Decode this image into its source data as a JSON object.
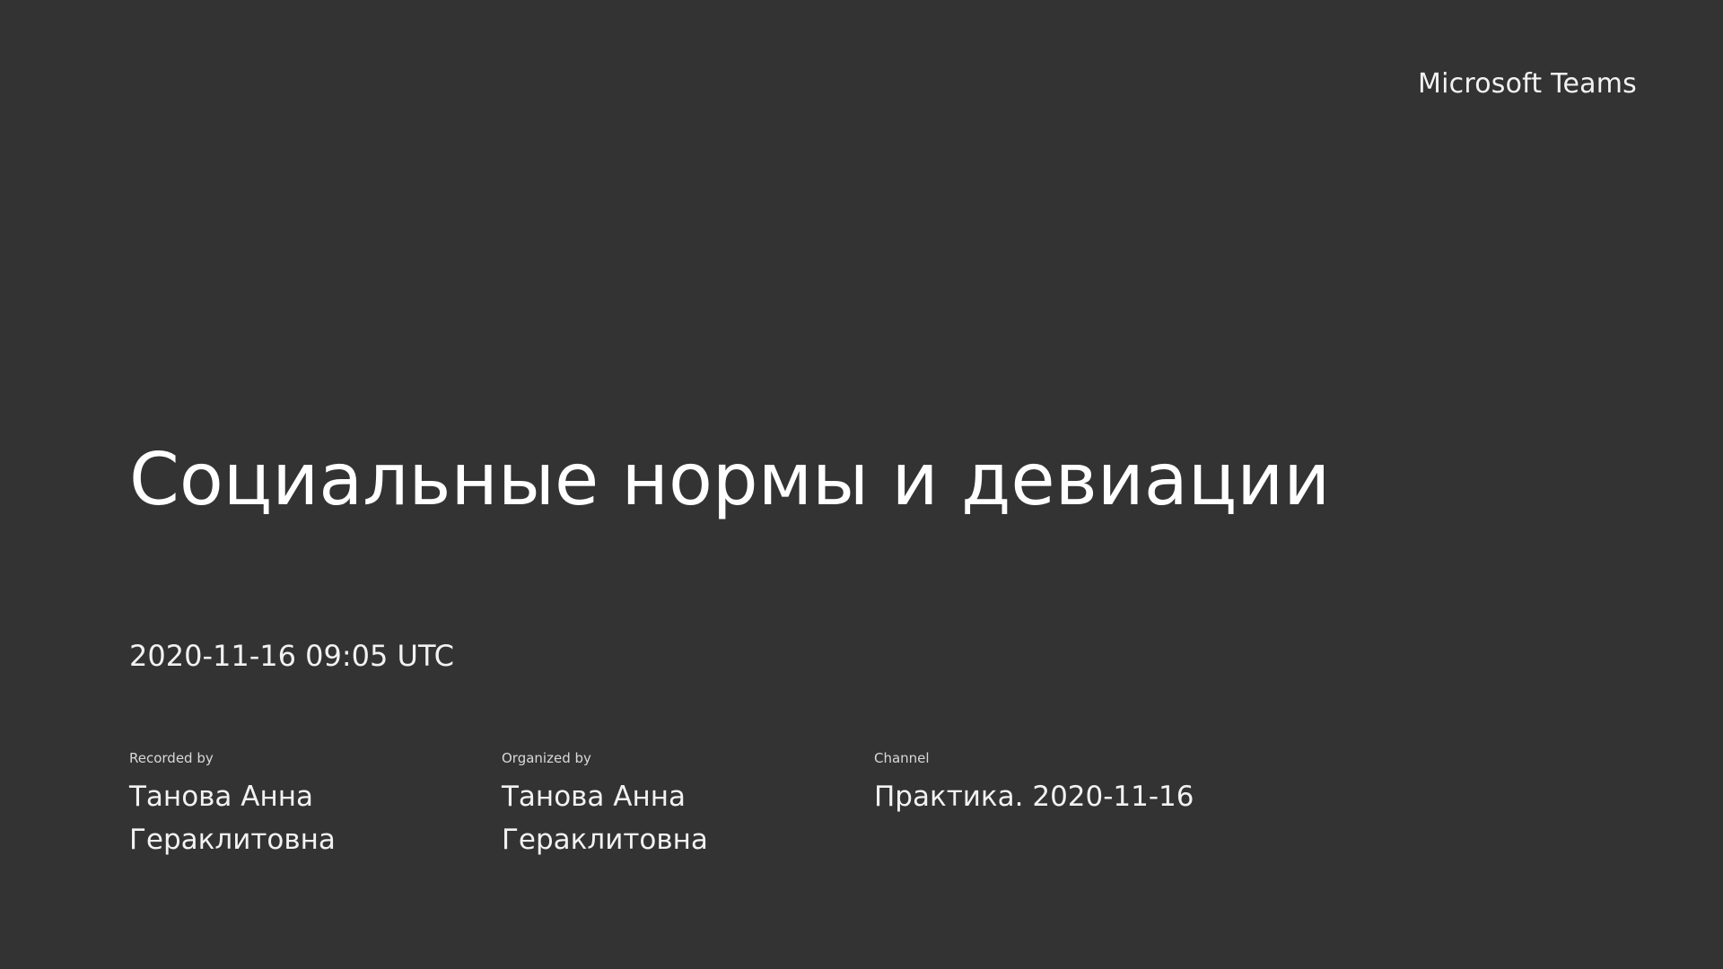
{
  "brand": {
    "name": "Microsoft Teams"
  },
  "meeting": {
    "title": "Социальные нормы и девиации",
    "datetime": "2020-11-16 09:05 UTC"
  },
  "details": {
    "recorded_by": {
      "label": "Recorded by",
      "value": "Танова Анна Гераклитовна"
    },
    "organized_by": {
      "label": "Organized by",
      "value": "Танова Анна Гераклитовна"
    },
    "channel": {
      "label": "Channel",
      "value": "Практика. 2020-11-16"
    }
  },
  "colors": {
    "background": "#333333",
    "text": "#ffffff"
  }
}
